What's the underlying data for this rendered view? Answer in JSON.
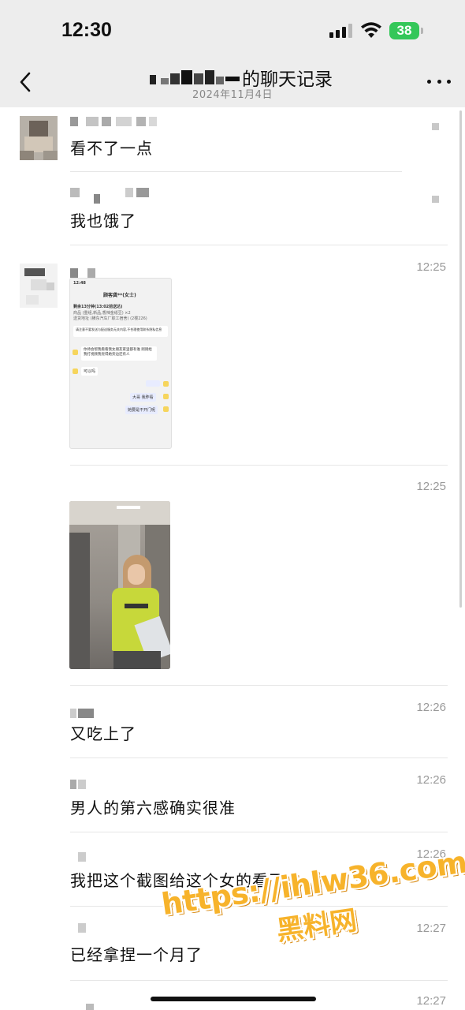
{
  "status_bar": {
    "time": "12:30",
    "battery": "38",
    "icons": [
      "signal-icon",
      "wifi-icon",
      "battery-icon"
    ]
  },
  "nav": {
    "title": "的聊天记录",
    "subtitle": "2024年11月4日",
    "back_icon": "chevron-left-icon",
    "more_icon": "more-dots-icon"
  },
  "messages": [
    {
      "text": "看不了一点",
      "time": ""
    },
    {
      "text": "我也饿了",
      "time": ""
    },
    {
      "text": "",
      "time": "12:25",
      "image": "screenshot-thumbnail"
    },
    {
      "text": "",
      "time": "12:25",
      "image": "photo-thumbnail"
    },
    {
      "text": "又吃上了",
      "time": "12:26"
    },
    {
      "text": "男人的第六感确实很准",
      "time": "12:26"
    },
    {
      "text": "我把这个截图给这个女的看了",
      "time": "12:26"
    },
    {
      "text": "已经拿捏一个月了",
      "time": "12:27"
    },
    {
      "text": "",
      "time": "12:27"
    }
  ],
  "screenshot_thumb": {
    "time": "12:48",
    "contact": "顾客龚**(女士)",
    "row1": "剩余13分钟(13:02前送达)",
    "row2": "商品 (重组,新品,香辣金纸豆) ×2",
    "row3": "送货地址 (横东汽车厂职工宿舍) (2楼226)",
    "notice": "请注意不要发送与配送服务无关内容,不合理使用联系隐私信息",
    "bubble1": "你待会帮我看看我女朋友家里都有谁 刚刚给我打视频我觉得她旁边还有人",
    "bubble2": "可以吗",
    "bubble3": "大哥 我昨看",
    "bubble4": "她要是不开门呢"
  },
  "watermark": {
    "url": "https://ihlw36.com",
    "name": "黑料网"
  }
}
